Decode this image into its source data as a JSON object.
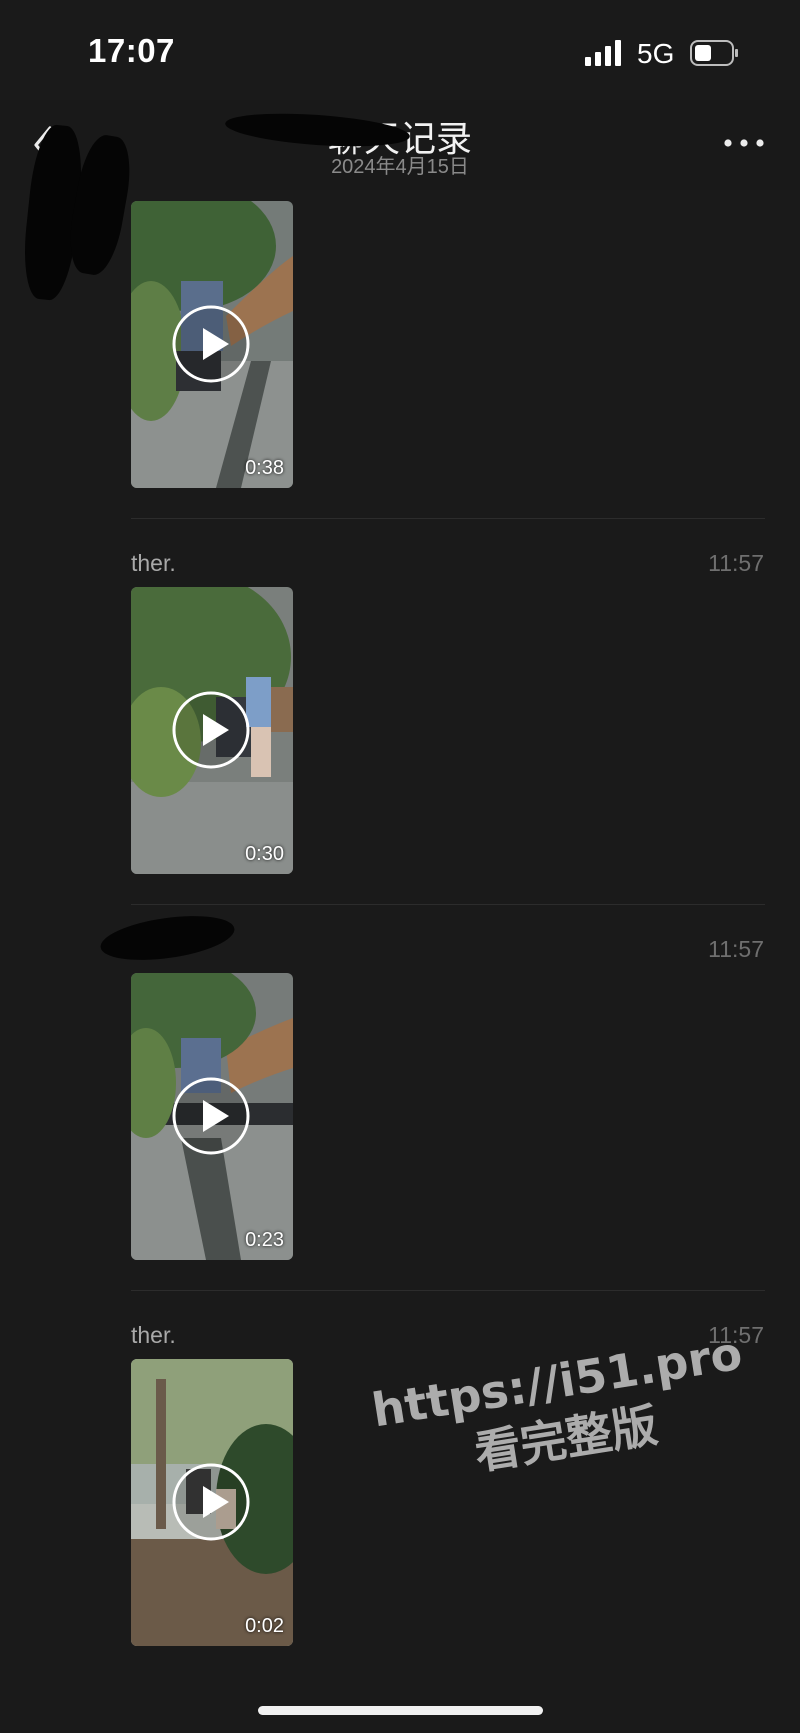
{
  "status_bar": {
    "time": "17:07",
    "network": "5G"
  },
  "nav": {
    "title": "聊天记录",
    "subtitle": "2024年4月15日"
  },
  "messages": [
    {
      "sender": "",
      "time": "",
      "video_duration": "0:38"
    },
    {
      "sender": "ther.",
      "time": "11:57",
      "video_duration": "0:30"
    },
    {
      "sender": "",
      "time": "11:57",
      "video_duration": "0:23"
    },
    {
      "sender": "ther.",
      "time": "11:57",
      "video_duration": "0:02"
    }
  ],
  "watermark": {
    "line1": "https://i51.pro",
    "line2": "看完整版"
  },
  "colors": {
    "background": "#1a1a1a",
    "nav_bar": "#191919",
    "divider": "#2c2c2c",
    "timestamp": "#6f6f6f"
  },
  "icons": [
    "signal-icon",
    "battery-icon",
    "back-arrow-icon",
    "more-icon",
    "play-icon"
  ]
}
